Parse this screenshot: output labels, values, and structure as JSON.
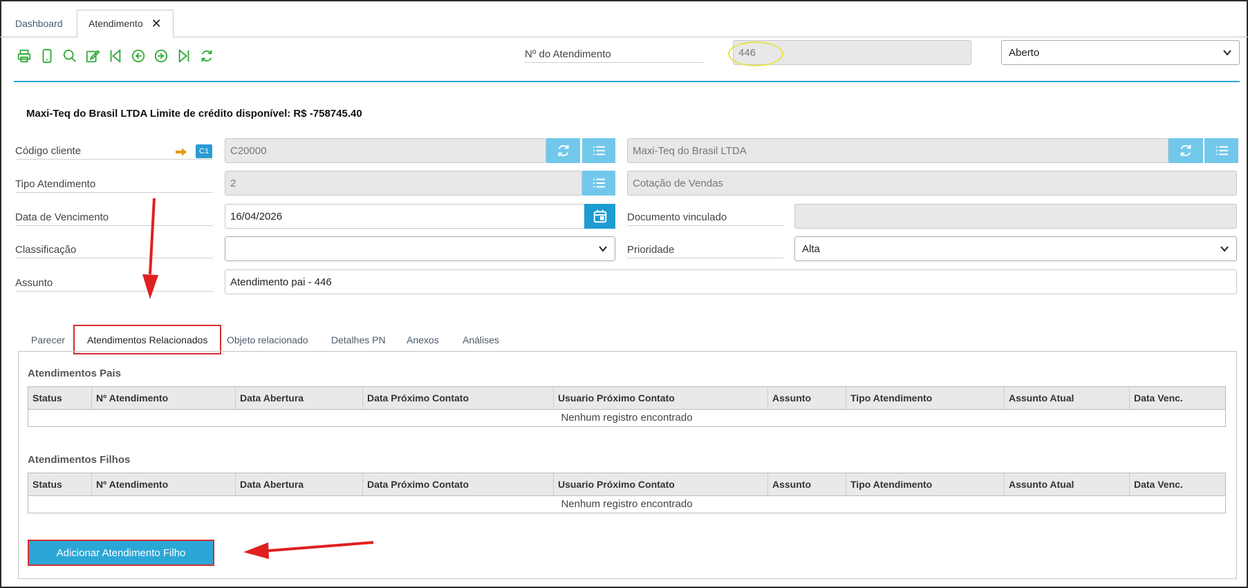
{
  "tabs": [
    {
      "label": "Dashboard"
    },
    {
      "label": "Atendimento"
    }
  ],
  "header": {
    "numero_label": "Nº do Atendimento",
    "numero_value": "446",
    "status_value": "Aberto"
  },
  "company_line": "Maxi-Teq do Brasil LTDA Limite de crédito disponível: R$ -758745.40",
  "form": {
    "codigo_cliente_label": "Código cliente",
    "c1_badge": "C1",
    "codigo_cliente_value": "C20000",
    "cliente_nome_value": "Maxi-Teq do Brasil LTDA",
    "tipo_atendimento_label": "Tipo Atendimento",
    "tipo_atendimento_value": "2",
    "tipo_atendimento_desc": "Cotação de Vendas",
    "data_vencimento_label": "Data de Vencimento",
    "data_vencimento_value": "16/04/2026",
    "documento_vinculado_label": "Documento vinculado",
    "documento_vinculado_value": "",
    "classificacao_label": "Classificação",
    "classificacao_value": "",
    "prioridade_label": "Prioridade",
    "prioridade_value": "Alta",
    "assunto_label": "Assunto",
    "assunto_value": "Atendimento pai - 446"
  },
  "inner_tabs": [
    {
      "label": "Parecer"
    },
    {
      "label": "Atendimentos Relacionados"
    },
    {
      "label": "Objeto relacionado"
    },
    {
      "label": "Detalhes PN"
    },
    {
      "label": "Anexos"
    },
    {
      "label": "Análises"
    }
  ],
  "pais": {
    "title": "Atendimentos Pais",
    "columns": [
      "Status",
      "Nº Atendimento",
      "Data Abertura",
      "Data Próximo Contato",
      "Usuario Próximo Contato",
      "Assunto",
      "Tipo Atendimento",
      "Assunto Atual",
      "Data Venc."
    ],
    "empty": "Nenhum registro encontrado"
  },
  "filhos": {
    "title": "Atendimentos Filhos",
    "columns": [
      "Status",
      "Nº Atendimento",
      "Data Abertura",
      "Data Próximo Contato",
      "Usuario Próximo Contato",
      "Assunto",
      "Tipo Atendimento",
      "Assunto Atual",
      "Data Venc."
    ],
    "empty": "Nenhum registro encontrado"
  },
  "add_button_label": "Adicionar Atendimento Filho",
  "colors": {
    "accent": "#2aa3d6",
    "icon_green": "#2daa36",
    "annotation_red": "#d62e2e",
    "highlight_yellow": "#e6e34a"
  },
  "toolbar_icons": [
    "print-icon",
    "mobile-icon",
    "search-icon",
    "edit-icon",
    "first-icon",
    "prev-icon",
    "next-icon",
    "last-icon",
    "refresh-icon"
  ]
}
